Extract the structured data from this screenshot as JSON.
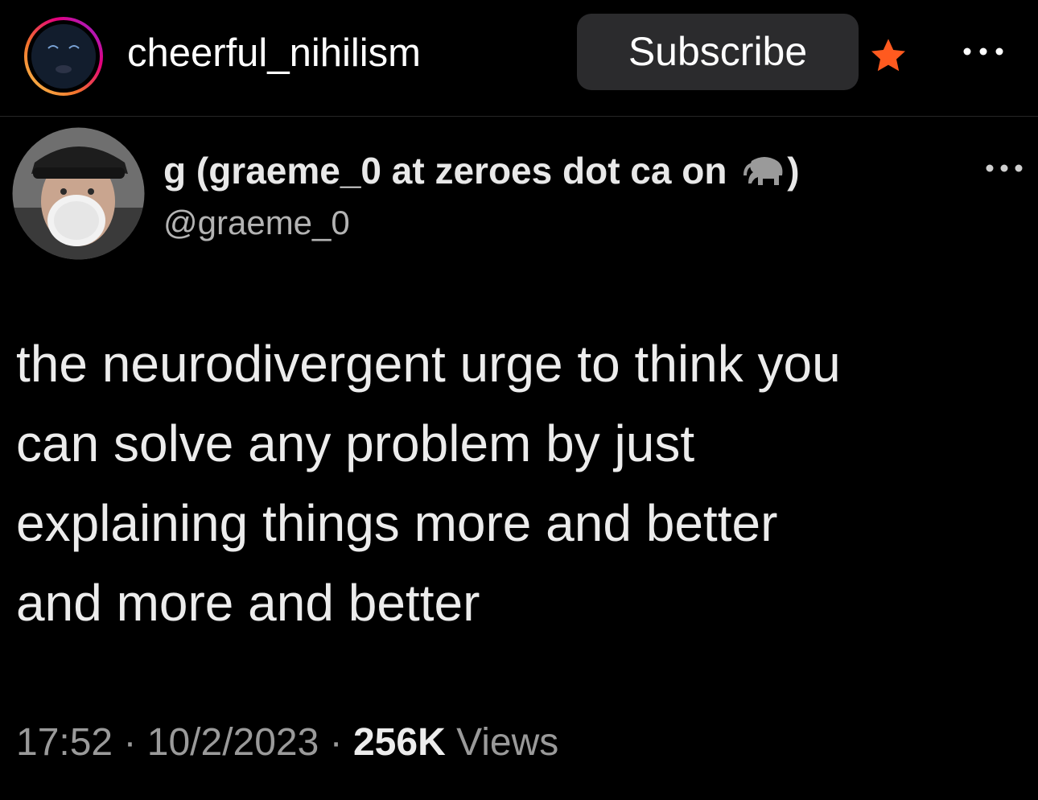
{
  "header": {
    "username": "cheerful_nihilism",
    "subscribe_label": "Subscribe",
    "star_color": "#ff5a1f",
    "ring_colors": [
      "#f9c74f",
      "#f3722c",
      "#e4007c",
      "#8a2be2"
    ],
    "menu_icon": "more-horizontal-icon"
  },
  "tweet": {
    "display_name_prefix": "g (graeme_0 at zeroes dot ca on ",
    "display_name_suffix": ")",
    "display_name_icon": "elephant-icon",
    "handle": "@graeme_0",
    "text": "the neurodivergent urge to think you\ncan solve any problem by just\nexplaining things more and better\nand more and better",
    "time": "17:52",
    "separator": " · ",
    "date": "10/2/2023",
    "views_count": "256K",
    "views_label": " Views",
    "menu_icon": "more-horizontal-icon"
  }
}
